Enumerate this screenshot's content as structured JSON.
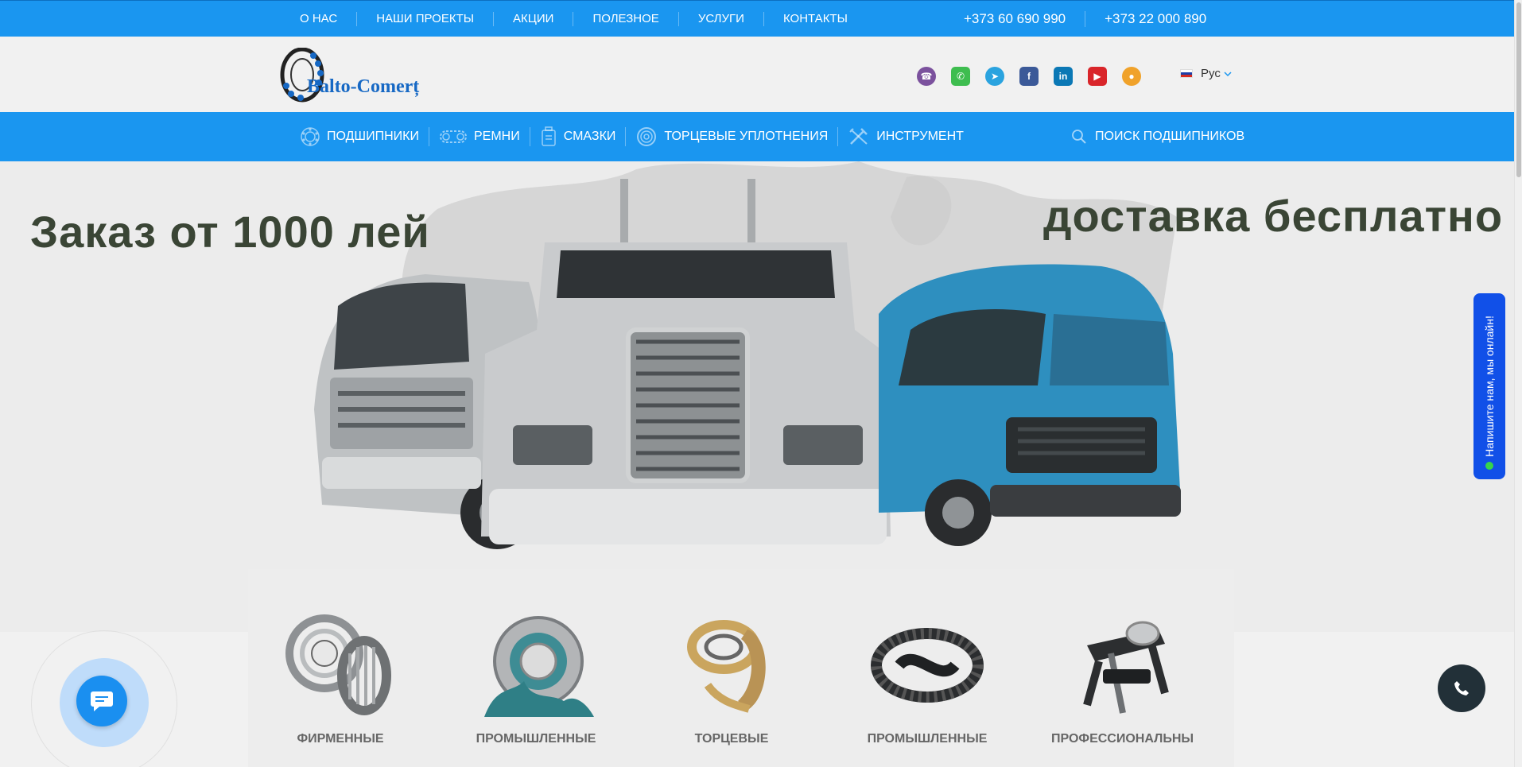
{
  "topbar": {
    "nav": [
      "О НАС",
      "НАШИ ПРОЕКТЫ",
      "АКЦИИ",
      "ПОЛЕЗНОЕ",
      "УСЛУГИ",
      "КОНТАКТЫ"
    ],
    "phones": [
      "+373 60 690 990",
      "+373 22 000 890"
    ]
  },
  "header": {
    "logo_text": "Balto-Comerț",
    "socials": [
      {
        "icon": "viber-icon",
        "color": "#7b519d",
        "glyph": "☎"
      },
      {
        "icon": "whatsapp-icon",
        "color": "#3ebd4f",
        "glyph": "✆"
      },
      {
        "icon": "telegram-icon",
        "color": "#2aa3df",
        "glyph": "➤"
      },
      {
        "icon": "facebook-icon",
        "color": "#3b5998",
        "glyph": "f"
      },
      {
        "icon": "linkedin-icon",
        "color": "#0b78b5",
        "glyph": "in"
      },
      {
        "icon": "youtube-icon",
        "color": "#d9252a",
        "glyph": "▶"
      },
      {
        "icon": "chat-bird-icon",
        "color": "#f0a22a",
        "glyph": "●"
      }
    ],
    "language": "Рус"
  },
  "catnav": {
    "items": [
      {
        "label": "ПОДШИПНИКИ",
        "icon": "bearing-icon"
      },
      {
        "label": "РЕМНИ",
        "icon": "belt-icon"
      },
      {
        "label": "СМАЗКИ",
        "icon": "lubricant-icon"
      },
      {
        "label": "ТОРЦЕВЫЕ УПЛОТНЕНИЯ",
        "icon": "seal-icon"
      },
      {
        "label": "ИНСТРУМЕНТ",
        "icon": "tools-icon"
      }
    ],
    "search_label": "ПОИСК ПОДШИПНИКОВ"
  },
  "hero": {
    "left_text": "Заказ от 1000 лей",
    "right_text": "доставка бесплатно"
  },
  "cards": [
    {
      "label": "ФИРМЕННЫЕ ПОДШИПНИКИ",
      "icon": "bearings-product-icon"
    },
    {
      "label": "ПРОМЫШЛЕННЫЕ СМАЗКИ",
      "icon": "grease-product-icon"
    },
    {
      "label": "ТОРЦЕВЫЕ УПЛОТНЕНИЯ",
      "icon": "seal-product-icon"
    },
    {
      "label": "ПРОМЫШЛЕННЫЕ РЕМНИ",
      "icon": "belt-product-icon"
    },
    {
      "label": "ПРОФЕССИОНАЛЬНЫЙ ИНСТРУМЕНТ",
      "icon": "puller-product-icon"
    }
  ],
  "widget": {
    "online_text": "Напишите нам, мы онлайн!"
  },
  "colors": {
    "accent": "#1a96f0",
    "widget": "#1150e8",
    "hero_text": "#3a4535"
  }
}
